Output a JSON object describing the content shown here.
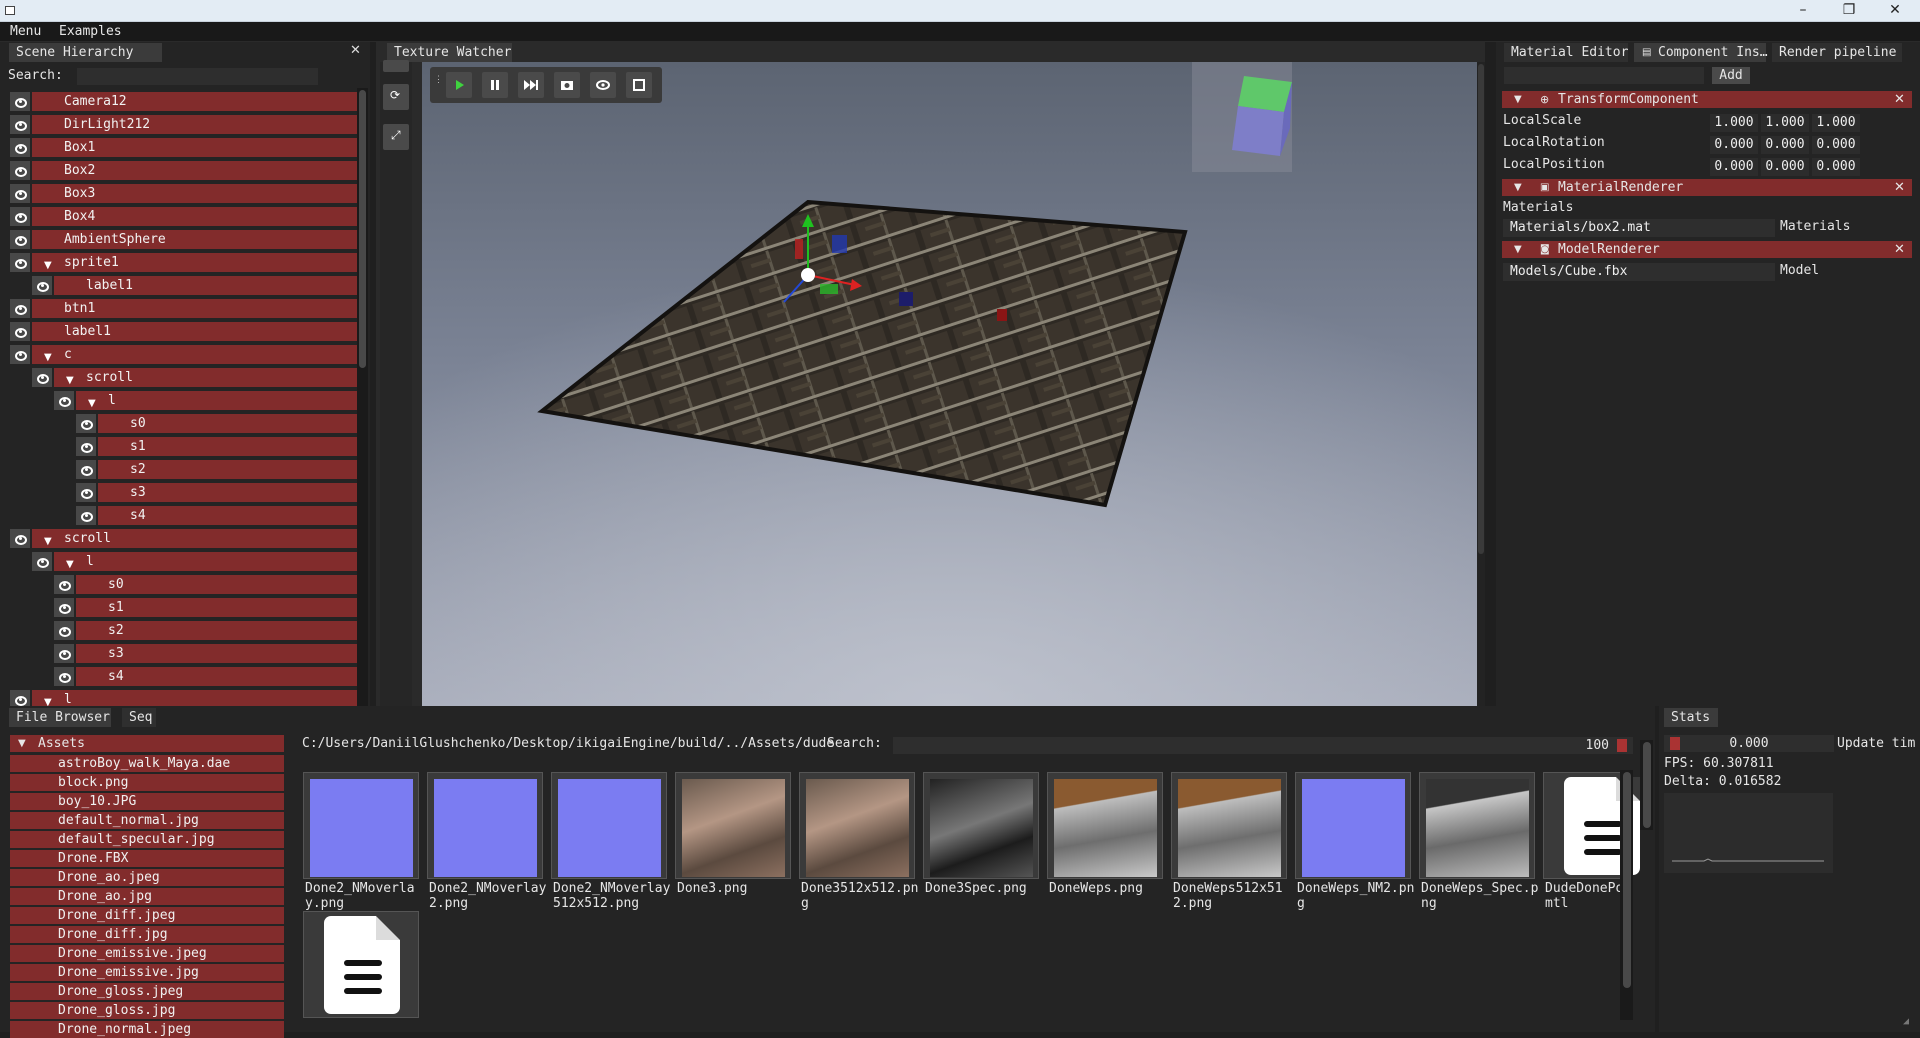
{
  "menubar": {
    "items": [
      "Menu",
      "Examples"
    ]
  },
  "hierarchy": {
    "tab": "Scene Hierarchy",
    "search_label": "Search:",
    "search_value": "",
    "items": [
      {
        "label": "Camera12",
        "depth": 0,
        "expanded": null
      },
      {
        "label": "DirLight212",
        "depth": 0,
        "expanded": null
      },
      {
        "label": "Box1",
        "depth": 0,
        "expanded": null
      },
      {
        "label": "Box2",
        "depth": 0,
        "expanded": null
      },
      {
        "label": "Box3",
        "depth": 0,
        "expanded": null
      },
      {
        "label": "Box4",
        "depth": 0,
        "expanded": null
      },
      {
        "label": "AmbientSphere",
        "depth": 0,
        "expanded": null
      },
      {
        "label": "sprite1",
        "depth": 0,
        "expanded": true
      },
      {
        "label": "label1",
        "depth": 1,
        "expanded": null
      },
      {
        "label": "btn1",
        "depth": 0,
        "expanded": null
      },
      {
        "label": "label1",
        "depth": 0,
        "expanded": null
      },
      {
        "label": "c",
        "depth": 0,
        "expanded": true
      },
      {
        "label": "scroll",
        "depth": 1,
        "expanded": true
      },
      {
        "label": "l",
        "depth": 2,
        "expanded": true
      },
      {
        "label": "s0",
        "depth": 3,
        "expanded": null
      },
      {
        "label": "s1",
        "depth": 3,
        "expanded": null
      },
      {
        "label": "s2",
        "depth": 3,
        "expanded": null
      },
      {
        "label": "s3",
        "depth": 3,
        "expanded": null
      },
      {
        "label": "s4",
        "depth": 3,
        "expanded": null
      },
      {
        "label": "scroll",
        "depth": 0,
        "expanded": true
      },
      {
        "label": "l",
        "depth": 1,
        "expanded": true
      },
      {
        "label": "s0",
        "depth": 2,
        "expanded": null
      },
      {
        "label": "s1",
        "depth": 2,
        "expanded": null
      },
      {
        "label": "s2",
        "depth": 2,
        "expanded": null
      },
      {
        "label": "s3",
        "depth": 2,
        "expanded": null
      },
      {
        "label": "s4",
        "depth": 2,
        "expanded": null
      },
      {
        "label": "l",
        "depth": 0,
        "expanded": true
      }
    ]
  },
  "viewport": {
    "tab": "Texture Watcher"
  },
  "inspector": {
    "tabs": [
      "Material Editor",
      "Component Ins…",
      "Render pipeline"
    ],
    "add_label": "Add",
    "add_input": "",
    "transform": {
      "title": "TransformComponent",
      "rows": [
        {
          "label": "LocalScale",
          "values": [
            "1.000",
            "1.000",
            "1.000"
          ]
        },
        {
          "label": "LocalRotation",
          "values": [
            "0.000",
            "0.000",
            "0.000"
          ]
        },
        {
          "label": "LocalPosition",
          "values": [
            "0.000",
            "0.000",
            "0.000"
          ]
        }
      ]
    },
    "material": {
      "title": "MaterialRenderer",
      "materials_label": "Materials",
      "path": "Materials/box2.mat",
      "field_label": "Materials"
    },
    "model": {
      "title": "ModelRenderer",
      "path": "Models/Cube.fbx",
      "field_label": "Model"
    }
  },
  "filebrowser": {
    "tabs": [
      "File Browser",
      "Seq"
    ],
    "root": "Assets",
    "assets": [
      "astroBoy_walk_Maya.dae",
      "block.png",
      "boy_10.JPG",
      "default_normal.jpg",
      "default_specular.jpg",
      "Drone.FBX",
      "Drone_ao.jpeg",
      "Drone_ao.jpg",
      "Drone_diff.jpeg",
      "Drone_diff.jpg",
      "Drone_emissive.jpeg",
      "Drone_emissive.jpg",
      "Drone_gloss.jpeg",
      "Drone_gloss.jpg",
      "Drone_normal.jpeg"
    ],
    "path": "C:/Users/DaniilGlushchenko/Desktop/ikigaiEngine/build/../Assets/dude",
    "search_label": "Search:",
    "search_value": "",
    "size_value": "100",
    "files": [
      {
        "name": "Done2_NMoverlay.png",
        "kind": "normal"
      },
      {
        "name": "Done2_NMoverlay2.png",
        "kind": "normal"
      },
      {
        "name": "Done2_NMoverlay512x512.png",
        "kind": "normal"
      },
      {
        "name": "Done3.png",
        "kind": "diffuse"
      },
      {
        "name": "Done3512x512.png",
        "kind": "diffuse"
      },
      {
        "name": "Done3Spec.png",
        "kind": "spec"
      },
      {
        "name": "DoneWeps.png",
        "kind": "weps"
      },
      {
        "name": "DoneWeps512x512.png",
        "kind": "weps"
      },
      {
        "name": "DoneWeps_NM2.png",
        "kind": "normal"
      },
      {
        "name": "DoneWeps_Spec.png",
        "kind": "wepsspec"
      },
      {
        "name": "DudeDonePomtl",
        "kind": "doc"
      },
      {
        "name": "",
        "kind": "doc"
      }
    ]
  },
  "stats": {
    "tab": "Stats",
    "value": "0.000",
    "update_label": "Update tim",
    "fps": "FPS: 60.307811",
    "delta": "Delta: 0.016582"
  },
  "colors": {
    "accent_red": "#822c2c",
    "panel": "#242424",
    "play_green": "#3fd33f"
  }
}
